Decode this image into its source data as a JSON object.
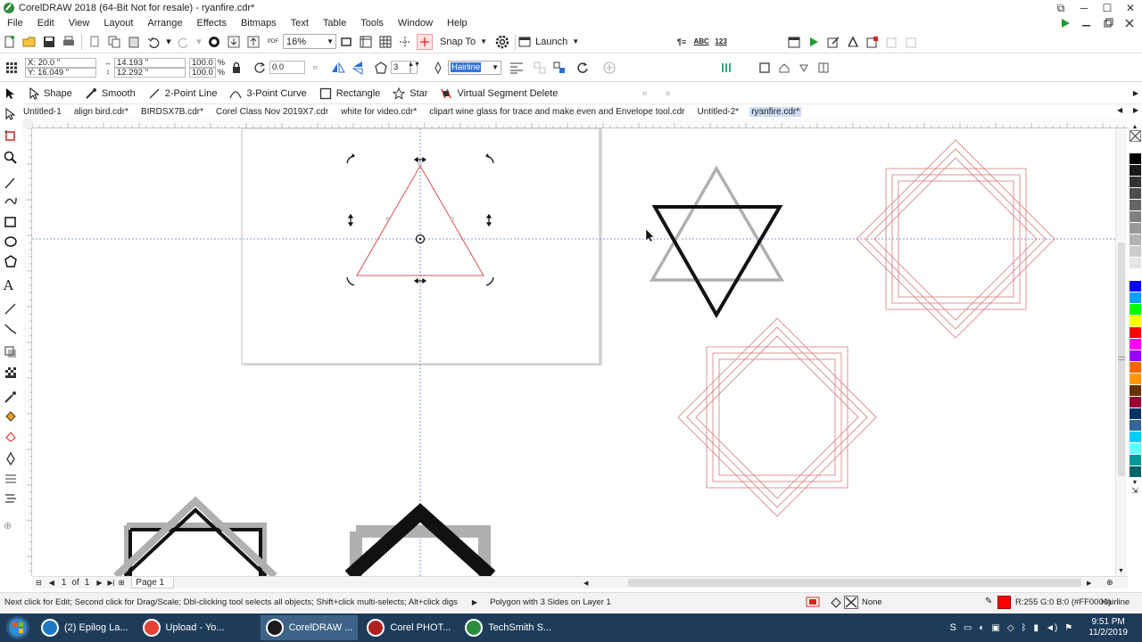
{
  "window": {
    "title": "CorelDRAW 2018 (64-Bit Not for resale) - ryanfire.cdr*"
  },
  "menu": [
    "File",
    "Edit",
    "View",
    "Layout",
    "Arrange",
    "Effects",
    "Bitmaps",
    "Text",
    "Table",
    "Tools",
    "Window",
    "Help"
  ],
  "toolbar": {
    "zoom_value": "16%",
    "snap_to_label": "Snap To",
    "launch_label": "Launch",
    "pdf_label": "PDF"
  },
  "property_bar": {
    "x": "X: 20.0 \"",
    "y": "Y: 16.049 \"",
    "width": "14.193 \"",
    "height": "12.292 \"",
    "scale_w": "100.0",
    "scale_h": "100.0",
    "pct1": "%",
    "pct2": "%",
    "rotation": "0.0",
    "sides": "3",
    "outline": "Hairline"
  },
  "tool_bar": [
    "Shape",
    "Smooth",
    "2-Point Line",
    "3-Point Curve",
    "Rectangle",
    "Star",
    "Virtual Segment Delete"
  ],
  "tabs": [
    {
      "label": "Untitled-1",
      "active": false
    },
    {
      "label": "align bird.cdr*",
      "active": false
    },
    {
      "label": "BIRDSX7B.cdr*",
      "active": false
    },
    {
      "label": "Corel Class Nov 2019X7.cdr",
      "active": false
    },
    {
      "label": "white for video.cdr*",
      "active": false
    },
    {
      "label": "clipart wine glass for trace and make even and Envelope tool.cdr",
      "active": false
    },
    {
      "label": "Untitled-2*",
      "active": false
    },
    {
      "label": "ryanfire.cdr*",
      "active": true
    }
  ],
  "page_nav": {
    "current": "1",
    "of": "of",
    "total": "1",
    "page_tab": "Page 1"
  },
  "status": {
    "hint": "Next click for Edit; Second click for Drag/Scale; Dbl-clicking tool selects all objects; Shift+click multi-selects; Alt+click digs",
    "selection": "Polygon with 3 Sides on Layer 1",
    "fill_label": "None",
    "outline_color": "R:255 G:0 B:0 (#FF0000)",
    "outline_width": "Hairline"
  },
  "taskbar": {
    "items": [
      {
        "label": "(2) Epilog La...",
        "active": false
      },
      {
        "label": "Upload - Yo...",
        "active": false
      },
      {
        "label": "CorelDRAW ...",
        "active": true
      },
      {
        "label": "Corel PHOT...",
        "active": false
      },
      {
        "label": "TechSmith S...",
        "active": false
      }
    ],
    "time": "9:51 PM",
    "date": "11/2/2019"
  },
  "colors": {
    "accent": "#ff0000",
    "taskbar": "#1e3c5a",
    "selection_tab": "#ccdcf5"
  },
  "palette": [
    "#ffffff",
    "#000000",
    "#1a1a1a",
    "#333333",
    "#4d4d4d",
    "#666666",
    "#808080",
    "#999999",
    "#b3b3b3",
    "#cccccc",
    "#e6e6e6",
    "#ffffff",
    "#0000ff",
    "#00a0ff",
    "#00ff00",
    "#ffff00",
    "#ff0000",
    "#ff00ff",
    "#9900ff",
    "#ff6600",
    "#ff9900",
    "#663300",
    "#990033",
    "#003366",
    "#336699",
    "#00ccff",
    "#66ffff",
    "#009999",
    "#006666"
  ]
}
